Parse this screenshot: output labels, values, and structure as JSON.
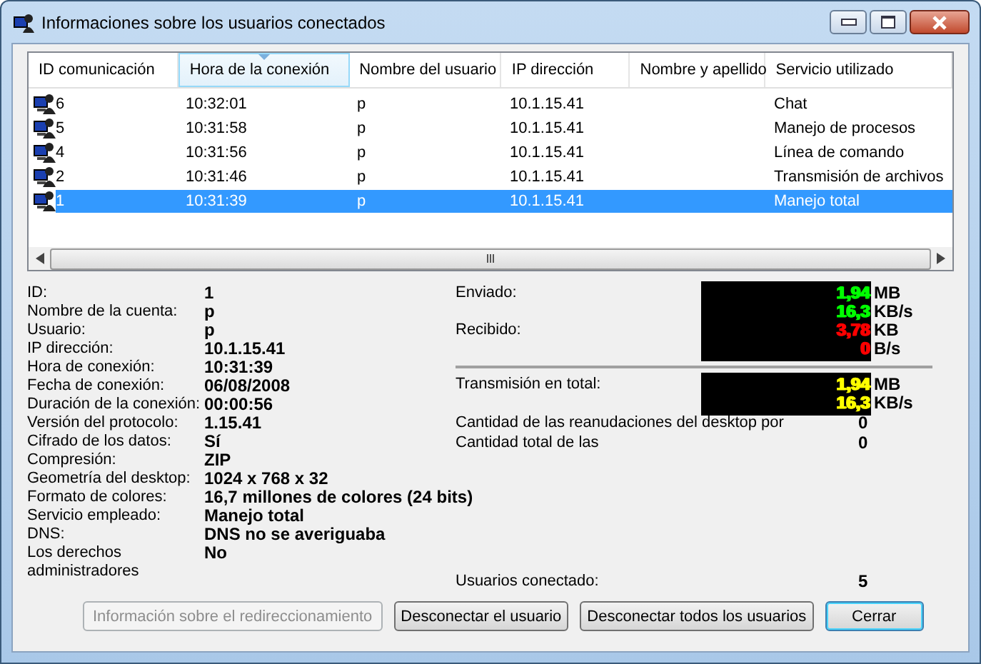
{
  "window": {
    "title": "Informaciones sobre los usuarios conectados"
  },
  "list": {
    "columns": [
      {
        "label": "ID comunicación",
        "sorted": false
      },
      {
        "label": "Hora de la conexión",
        "sorted": true
      },
      {
        "label": "Nombre del usuario",
        "sorted": false
      },
      {
        "label": "IP dirección",
        "sorted": false
      },
      {
        "label": "Nombre y apellido",
        "sorted": false
      },
      {
        "label": "Servicio utilizado",
        "sorted": false
      }
    ],
    "rows": [
      {
        "id": "6",
        "time": "10:32:01",
        "user": "p",
        "ip": "10.1.15.41",
        "service": "Chat",
        "selected": false
      },
      {
        "id": "5",
        "time": "10:31:58",
        "user": "p",
        "ip": "10.1.15.41",
        "service": "Manejo de procesos",
        "selected": false
      },
      {
        "id": "4",
        "time": "10:31:56",
        "user": "p",
        "ip": "10.1.15.41",
        "service": "Línea de comando",
        "selected": false
      },
      {
        "id": "2",
        "time": "10:31:46",
        "user": "p",
        "ip": "10.1.15.41",
        "service": "Transmisión de archivos",
        "selected": false
      },
      {
        "id": "1",
        "time": "10:31:39",
        "user": "p",
        "ip": "10.1.15.41",
        "service": "Manejo total",
        "selected": true
      }
    ]
  },
  "details": [
    {
      "label": "ID:",
      "value": "1"
    },
    {
      "label": "Nombre de la cuenta:",
      "value": "p"
    },
    {
      "label": "Usuario:",
      "value": "p"
    },
    {
      "label": "IP dirección:",
      "value": "10.1.15.41"
    },
    {
      "label": "Hora de conexión:",
      "value": "10:31:39"
    },
    {
      "label": "Fecha de conexión:",
      "value": "06/08/2008"
    },
    {
      "label": "Duración de la conexión:",
      "value": "00:00:56"
    },
    {
      "label": "Versión del protocolo:",
      "value": "1.15.41"
    },
    {
      "label": "Cifrado de los datos:",
      "value": "Sí"
    },
    {
      "label": "Compresión:",
      "value": "ZIP"
    },
    {
      "label": "Geometría del desktop:",
      "value": "1024 x 768 x 32"
    },
    {
      "label": "Formato de colores:",
      "value": "16,7 millones de colores (24 bits)"
    },
    {
      "label": "Servicio empleado:",
      "value": "Manejo total"
    },
    {
      "label": "DNS:",
      "value": "DNS no se averiguaba"
    },
    {
      "label": "Los derechos administradores",
      "value": "No"
    }
  ],
  "traffic": [
    {
      "entries": [
        {
          "label": "Enviado:",
          "lines": [
            {
              "value": "1,94",
              "unit": "MB",
              "color": "#00ff00"
            },
            {
              "value": "16,3",
              "unit": "KB/s",
              "color": "#00ff00"
            }
          ]
        },
        {
          "label": "Recibido:",
          "lines": [
            {
              "value": "3,78",
              "unit": "KB",
              "color": "#ff0000"
            },
            {
              "value": "0",
              "unit": "B/s",
              "color": "#ff0000"
            }
          ]
        }
      ]
    },
    {
      "entries": [
        {
          "label": "Transmisión en total:",
          "lines": [
            {
              "value": "1,94",
              "unit": "MB",
              "color": "#ffff00"
            },
            {
              "value": "16,3",
              "unit": "KB/s",
              "color": "#ffff00"
            }
          ]
        }
      ]
    }
  ],
  "counts": [
    {
      "label": "Cantidad de las reanudaciones del desktop por",
      "value": "0"
    },
    {
      "label": "Cantidad total de las",
      "value": "0"
    }
  ],
  "connected": {
    "label": "Usuarios conectado:",
    "value": "5"
  },
  "buttons": [
    {
      "label": "Información sobre el redireccionamiento",
      "disabled": true,
      "default": false
    },
    {
      "label": "Desconectar el usuario",
      "disabled": false,
      "default": false
    },
    {
      "label": "Desconectar todos los usuarios",
      "disabled": false,
      "default": false
    },
    {
      "label": "Cerrar",
      "disabled": false,
      "default": true
    }
  ]
}
